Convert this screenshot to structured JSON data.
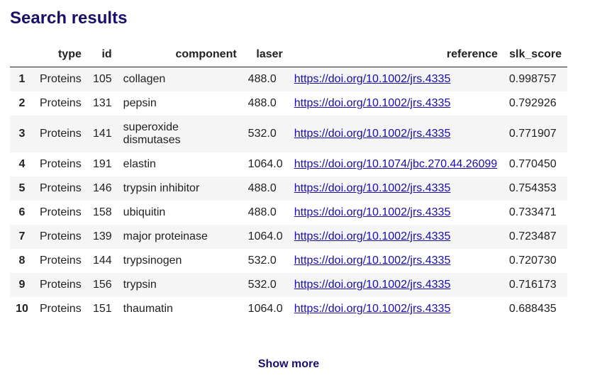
{
  "title": "Search results",
  "columns": {
    "rownum": "",
    "type": "type",
    "id": "id",
    "component": "component",
    "laser": "laser",
    "reference": "reference",
    "slk_score": "slk_score"
  },
  "rows": [
    {
      "n": "1",
      "type": "Proteins",
      "id": "105",
      "component": "collagen",
      "laser": "488.0",
      "reference": "https://doi.org/10.1002/jrs.4335",
      "slk_score": "0.998757"
    },
    {
      "n": "2",
      "type": "Proteins",
      "id": "131",
      "component": "pepsin",
      "laser": "488.0",
      "reference": "https://doi.org/10.1002/jrs.4335",
      "slk_score": "0.792926"
    },
    {
      "n": "3",
      "type": "Proteins",
      "id": "141",
      "component": "superoxide dismutases",
      "laser": "532.0",
      "reference": "https://doi.org/10.1002/jrs.4335",
      "slk_score": "0.771907"
    },
    {
      "n": "4",
      "type": "Proteins",
      "id": "191",
      "component": "elastin",
      "laser": "1064.0",
      "reference": "https://doi.org/10.1074/jbc.270.44.26099",
      "slk_score": "0.770450"
    },
    {
      "n": "5",
      "type": "Proteins",
      "id": "146",
      "component": "trypsin inhibitor",
      "laser": "488.0",
      "reference": "https://doi.org/10.1002/jrs.4335",
      "slk_score": "0.754353"
    },
    {
      "n": "6",
      "type": "Proteins",
      "id": "158",
      "component": "ubiquitin",
      "laser": "488.0",
      "reference": "https://doi.org/10.1002/jrs.4335",
      "slk_score": "0.733471"
    },
    {
      "n": "7",
      "type": "Proteins",
      "id": "139",
      "component": "major proteinase",
      "laser": "1064.0",
      "reference": "https://doi.org/10.1002/jrs.4335",
      "slk_score": "0.723487"
    },
    {
      "n": "8",
      "type": "Proteins",
      "id": "144",
      "component": "trypsinogen",
      "laser": "532.0",
      "reference": "https://doi.org/10.1002/jrs.4335",
      "slk_score": "0.720730"
    },
    {
      "n": "9",
      "type": "Proteins",
      "id": "156",
      "component": "trypsin",
      "laser": "532.0",
      "reference": "https://doi.org/10.1002/jrs.4335",
      "slk_score": "0.716173"
    },
    {
      "n": "10",
      "type": "Proteins",
      "id": "151",
      "component": "thaumatin",
      "laser": "1064.0",
      "reference": "https://doi.org/10.1002/jrs.4335",
      "slk_score": "0.688435"
    }
  ],
  "show_more_label": "Show more",
  "colors": {
    "title": "#1a0e6b",
    "link": "#1a0dab",
    "stripe": "#f5f5f5"
  }
}
